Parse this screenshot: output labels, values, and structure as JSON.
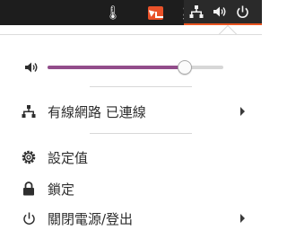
{
  "topbar": {
    "thermometer_icon": "thermometer-icon",
    "app_indicator_icon": "app-indicator-icon",
    "input_method": "英",
    "status_icons": [
      "network-wired-icon",
      "volume-icon",
      "power-icon"
    ],
    "accent_color": "#e95420"
  },
  "volume": {
    "icon": "volume-icon",
    "level": 0.78,
    "fill_color": "#924d8b"
  },
  "menu": {
    "network": {
      "icon": "network-wired-icon",
      "label": "有線網路 已連線",
      "has_submenu": true
    },
    "settings": {
      "icon": "settings-icon",
      "label": "設定值"
    },
    "lock": {
      "icon": "lock-icon",
      "label": "鎖定"
    },
    "power": {
      "icon": "power-icon",
      "label": "關閉電源/登出",
      "has_submenu": true
    }
  }
}
